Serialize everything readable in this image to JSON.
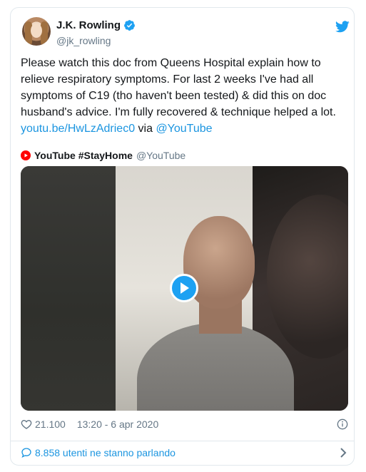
{
  "author": {
    "name": "J.K. Rowling",
    "handle": "@jk_rowling"
  },
  "tweet": {
    "text": "Please watch this doc from Queens Hospital explain how to relieve respiratory symptoms. For last 2 weeks I've had all symptoms of C19 (tho haven't been tested) & did this on doc husband's advice. I'm fully recovered & technique helped a lot. ",
    "link": "youtu.be/HwLzAdriec0",
    "via_word": " via ",
    "via_handle": "@YouTube"
  },
  "embed": {
    "channel_name": "YouTube #StayHome",
    "channel_handle": "@YouTube"
  },
  "meta": {
    "likes": "21.100",
    "timestamp": "13:20 - 6 apr 2020"
  },
  "footer": {
    "conversation": "8.858 utenti ne stanno parlando"
  },
  "colors": {
    "accent": "#1da1f2",
    "link": "#1b95e0",
    "muted": "#657786",
    "youtube_red": "#ff0000"
  },
  "icons": [
    "verified-badge-icon",
    "twitter-bird-icon",
    "youtube-logo-icon",
    "play-icon",
    "heart-icon",
    "info-icon",
    "comment-bubble-icon",
    "chevron-right-icon"
  ]
}
